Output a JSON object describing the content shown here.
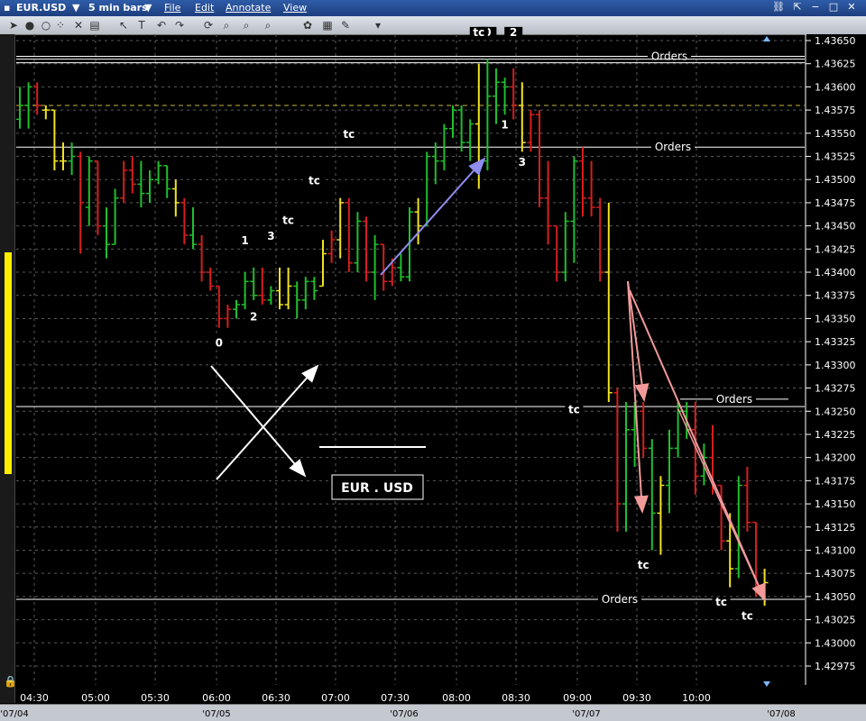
{
  "window": {
    "symbol": "EUR.USD",
    "interval": "5 min bars",
    "menus": [
      "File",
      "Edit",
      "Annotate",
      "View"
    ]
  },
  "toolbar": {
    "icons": [
      "cursor-icon",
      "circle-icon",
      "dots-icon",
      "cross-icon",
      "page-icon",
      "pointer-icon",
      "text-icon",
      "undo-icon",
      "redo-icon",
      "refresh-icon",
      "zoom-in-icon",
      "zoom-out-icon",
      "zoom-reset-icon",
      "palette-icon",
      "grid-icon",
      "dropdown-icon"
    ]
  },
  "colors": {
    "up": "#1fbf2c",
    "down": "#d61e1e",
    "flat": "#f0e320",
    "grid": "#5a5a5a",
    "orders_line": "#ffffff",
    "ref_dashed": "#c8b43a",
    "arrow_blue": "#8f8cf0",
    "arrow_pink": "#f29a9a",
    "scrollbar": "#ffee00"
  },
  "chart_data": {
    "type": "ohlc",
    "x_axis": {
      "time_labels": [
        "04:30",
        "05:00",
        "05:30",
        "06:00",
        "06:30",
        "07:00",
        "07:30",
        "08:00",
        "08:30",
        "09:00",
        "09:30",
        "10:00"
      ],
      "date_labels": [
        "'07/04",
        "'07/05",
        "'07/06",
        "'07/07",
        "'07/08"
      ]
    },
    "y_axis": {
      "range": [
        1.4295,
        1.4366
      ],
      "ticks": [
        "1.43650",
        "1.43625",
        "1.43600",
        "1.43575",
        "1.43550",
        "1.43525",
        "1.43500",
        "1.43475",
        "1.43450",
        "1.43425",
        "1.43400",
        "1.43375",
        "1.43350",
        "1.43325",
        "1.43300",
        "1.43275",
        "1.43250",
        "1.43225",
        "1.43200",
        "1.43175",
        "1.43150",
        "1.43125",
        "1.43100",
        "1.43075",
        "1.43050",
        "1.43025",
        "1.43000",
        "1.42975"
      ]
    },
    "bars": [
      {
        "o": 1.43565,
        "h": 1.436,
        "l": 1.43555,
        "c": 1.4358,
        "d": "up"
      },
      {
        "o": 1.4358,
        "h": 1.43605,
        "l": 1.43555,
        "c": 1.436,
        "d": "up"
      },
      {
        "o": 1.436,
        "h": 1.43605,
        "l": 1.4357,
        "c": 1.4358,
        "d": "down"
      },
      {
        "o": 1.43575,
        "h": 1.4358,
        "l": 1.43565,
        "c": 1.43575,
        "d": "flat"
      },
      {
        "o": 1.43575,
        "h": 1.43575,
        "l": 1.4351,
        "c": 1.4352,
        "d": "flat"
      },
      {
        "o": 1.4352,
        "h": 1.4354,
        "l": 1.4351,
        "c": 1.4352,
        "d": "flat"
      },
      {
        "o": 1.4352,
        "h": 1.4354,
        "l": 1.43505,
        "c": 1.43525,
        "d": "up"
      },
      {
        "o": 1.43525,
        "h": 1.4353,
        "l": 1.4342,
        "c": 1.43475,
        "d": "down"
      },
      {
        "o": 1.4347,
        "h": 1.43525,
        "l": 1.4345,
        "c": 1.4352,
        "d": "up"
      },
      {
        "o": 1.4352,
        "h": 1.4352,
        "l": 1.4344,
        "c": 1.4345,
        "d": "down"
      },
      {
        "o": 1.4345,
        "h": 1.4347,
        "l": 1.43415,
        "c": 1.4343,
        "d": "up"
      },
      {
        "o": 1.4343,
        "h": 1.4349,
        "l": 1.4343,
        "c": 1.4348,
        "d": "up"
      },
      {
        "o": 1.4348,
        "h": 1.4352,
        "l": 1.43475,
        "c": 1.4351,
        "d": "down"
      },
      {
        "o": 1.4351,
        "h": 1.43525,
        "l": 1.43485,
        "c": 1.43495,
        "d": "down"
      },
      {
        "o": 1.43495,
        "h": 1.4352,
        "l": 1.4347,
        "c": 1.43485,
        "d": "up"
      },
      {
        "o": 1.43485,
        "h": 1.4351,
        "l": 1.43475,
        "c": 1.435,
        "d": "up"
      },
      {
        "o": 1.435,
        "h": 1.4352,
        "l": 1.43495,
        "c": 1.43515,
        "d": "up"
      },
      {
        "o": 1.43515,
        "h": 1.43515,
        "l": 1.4348,
        "c": 1.4349,
        "d": "up"
      },
      {
        "o": 1.4349,
        "h": 1.435,
        "l": 1.4346,
        "c": 1.43475,
        "d": "flat"
      },
      {
        "o": 1.43475,
        "h": 1.4348,
        "l": 1.4343,
        "c": 1.4344,
        "d": "down"
      },
      {
        "o": 1.4344,
        "h": 1.4347,
        "l": 1.43425,
        "c": 1.4343,
        "d": "up"
      },
      {
        "o": 1.4343,
        "h": 1.4344,
        "l": 1.4339,
        "c": 1.434,
        "d": "down"
      },
      {
        "o": 1.434,
        "h": 1.43405,
        "l": 1.4338,
        "c": 1.43385,
        "d": "down"
      },
      {
        "o": 1.43385,
        "h": 1.43385,
        "l": 1.4334,
        "c": 1.4335,
        "d": "down"
      },
      {
        "o": 1.4335,
        "h": 1.43365,
        "l": 1.4334,
        "c": 1.4336,
        "d": "down"
      },
      {
        "o": 1.4336,
        "h": 1.4337,
        "l": 1.4335,
        "c": 1.43365,
        "d": "up"
      },
      {
        "o": 1.43365,
        "h": 1.434,
        "l": 1.4336,
        "c": 1.4339,
        "d": "up"
      },
      {
        "o": 1.4339,
        "h": 1.43405,
        "l": 1.4337,
        "c": 1.43375,
        "d": "up"
      },
      {
        "o": 1.43375,
        "h": 1.43405,
        "l": 1.43365,
        "c": 1.4337,
        "d": "down"
      },
      {
        "o": 1.4337,
        "h": 1.43385,
        "l": 1.43365,
        "c": 1.4338,
        "d": "up"
      },
      {
        "o": 1.4338,
        "h": 1.43405,
        "l": 1.4336,
        "c": 1.43365,
        "d": "yellow"
      },
      {
        "o": 1.43365,
        "h": 1.43405,
        "l": 1.4336,
        "c": 1.43385,
        "d": "yellow"
      },
      {
        "o": 1.43385,
        "h": 1.4339,
        "l": 1.4335,
        "c": 1.4337,
        "d": "up"
      },
      {
        "o": 1.4337,
        "h": 1.43395,
        "l": 1.4336,
        "c": 1.4339,
        "d": "up"
      },
      {
        "o": 1.4339,
        "h": 1.43395,
        "l": 1.4337,
        "c": 1.4338,
        "d": "up"
      },
      {
        "o": 1.43385,
        "h": 1.43435,
        "l": 1.43385,
        "c": 1.4342,
        "d": "yellow"
      },
      {
        "o": 1.4342,
        "h": 1.43445,
        "l": 1.4341,
        "c": 1.43435,
        "d": "down"
      },
      {
        "o": 1.43435,
        "h": 1.4348,
        "l": 1.43415,
        "c": 1.43475,
        "d": "yellow"
      },
      {
        "o": 1.43475,
        "h": 1.4348,
        "l": 1.434,
        "c": 1.4341,
        "d": "down"
      },
      {
        "o": 1.4341,
        "h": 1.43465,
        "l": 1.434,
        "c": 1.43455,
        "d": "up"
      },
      {
        "o": 1.43455,
        "h": 1.4346,
        "l": 1.4339,
        "c": 1.434,
        "d": "down"
      },
      {
        "o": 1.434,
        "h": 1.4344,
        "l": 1.4337,
        "c": 1.4343,
        "d": "up"
      },
      {
        "o": 1.4343,
        "h": 1.4343,
        "l": 1.4338,
        "c": 1.4339,
        "d": "down"
      },
      {
        "o": 1.4339,
        "h": 1.43415,
        "l": 1.43385,
        "c": 1.43405,
        "d": "down"
      },
      {
        "o": 1.43405,
        "h": 1.4342,
        "l": 1.4339,
        "c": 1.43395,
        "d": "up"
      },
      {
        "o": 1.43395,
        "h": 1.4347,
        "l": 1.4339,
        "c": 1.43465,
        "d": "up"
      },
      {
        "o": 1.43465,
        "h": 1.4348,
        "l": 1.4343,
        "c": 1.4345,
        "d": "yellow"
      },
      {
        "o": 1.4345,
        "h": 1.4353,
        "l": 1.4345,
        "c": 1.43525,
        "d": "up"
      },
      {
        "o": 1.43525,
        "h": 1.4354,
        "l": 1.43495,
        "c": 1.4352,
        "d": "up"
      },
      {
        "o": 1.4352,
        "h": 1.4356,
        "l": 1.4351,
        "c": 1.43555,
        "d": "up"
      },
      {
        "o": 1.43555,
        "h": 1.4358,
        "l": 1.43545,
        "c": 1.43575,
        "d": "up"
      },
      {
        "o": 1.43575,
        "h": 1.4358,
        "l": 1.4353,
        "c": 1.4354,
        "d": "up"
      },
      {
        "o": 1.4354,
        "h": 1.43565,
        "l": 1.4352,
        "c": 1.4356,
        "d": "up"
      },
      {
        "o": 1.4356,
        "h": 1.43625,
        "l": 1.4349,
        "c": 1.4352,
        "d": "yellow"
      },
      {
        "o": 1.4352,
        "h": 1.4363,
        "l": 1.4351,
        "c": 1.4359,
        "d": "up"
      },
      {
        "o": 1.4359,
        "h": 1.4362,
        "l": 1.4356,
        "c": 1.43605,
        "d": "up"
      },
      {
        "o": 1.43605,
        "h": 1.4361,
        "l": 1.4357,
        "c": 1.436,
        "d": "up"
      },
      {
        "o": 1.436,
        "h": 1.4362,
        "l": 1.43565,
        "c": 1.4358,
        "d": "down"
      },
      {
        "o": 1.4358,
        "h": 1.43605,
        "l": 1.4353,
        "c": 1.4354,
        "d": "yellow"
      },
      {
        "o": 1.4354,
        "h": 1.43575,
        "l": 1.4353,
        "c": 1.4357,
        "d": "down"
      },
      {
        "o": 1.4357,
        "h": 1.43575,
        "l": 1.4347,
        "c": 1.4348,
        "d": "down"
      },
      {
        "o": 1.4348,
        "h": 1.4352,
        "l": 1.4343,
        "c": 1.4345,
        "d": "down"
      },
      {
        "o": 1.4345,
        "h": 1.4345,
        "l": 1.4339,
        "c": 1.434,
        "d": "down"
      },
      {
        "o": 1.434,
        "h": 1.43465,
        "l": 1.4339,
        "c": 1.43455,
        "d": "up"
      },
      {
        "o": 1.43455,
        "h": 1.43525,
        "l": 1.4341,
        "c": 1.4352,
        "d": "up"
      },
      {
        "o": 1.4352,
        "h": 1.43535,
        "l": 1.4346,
        "c": 1.4348,
        "d": "down"
      },
      {
        "o": 1.4348,
        "h": 1.4352,
        "l": 1.4346,
        "c": 1.4347,
        "d": "down"
      },
      {
        "o": 1.4347,
        "h": 1.4348,
        "l": 1.4339,
        "c": 1.434,
        "d": "down"
      },
      {
        "o": 1.434,
        "h": 1.43475,
        "l": 1.4326,
        "c": 1.4327,
        "d": "yellow"
      },
      {
        "o": 1.4327,
        "h": 1.43275,
        "l": 1.4312,
        "c": 1.4315,
        "d": "down"
      },
      {
        "o": 1.4315,
        "h": 1.4326,
        "l": 1.4312,
        "c": 1.4323,
        "d": "up"
      },
      {
        "o": 1.4323,
        "h": 1.4326,
        "l": 1.4319,
        "c": 1.4325,
        "d": "up"
      },
      {
        "o": 1.4325,
        "h": 1.4326,
        "l": 1.432,
        "c": 1.4321,
        "d": "down"
      },
      {
        "o": 1.4321,
        "h": 1.4322,
        "l": 1.431,
        "c": 1.4314,
        "d": "up"
      },
      {
        "o": 1.4314,
        "h": 1.4318,
        "l": 1.43095,
        "c": 1.4317,
        "d": "yellow"
      },
      {
        "o": 1.4317,
        "h": 1.4323,
        "l": 1.4314,
        "c": 1.4321,
        "d": "up"
      },
      {
        "o": 1.4321,
        "h": 1.4326,
        "l": 1.432,
        "c": 1.4325,
        "d": "up"
      },
      {
        "o": 1.4325,
        "h": 1.4326,
        "l": 1.4322,
        "c": 1.4323,
        "d": "up"
      },
      {
        "o": 1.4323,
        "h": 1.4326,
        "l": 1.4316,
        "c": 1.4318,
        "d": "down"
      },
      {
        "o": 1.4318,
        "h": 1.43215,
        "l": 1.4317,
        "c": 1.432,
        "d": "up"
      },
      {
        "o": 1.432,
        "h": 1.43235,
        "l": 1.4316,
        "c": 1.4317,
        "d": "down"
      },
      {
        "o": 1.4317,
        "h": 1.4317,
        "l": 1.431,
        "c": 1.4311,
        "d": "down"
      },
      {
        "o": 1.4311,
        "h": 1.4314,
        "l": 1.4306,
        "c": 1.4308,
        "d": "yellow"
      },
      {
        "o": 1.4308,
        "h": 1.4318,
        "l": 1.4307,
        "c": 1.4317,
        "d": "up"
      },
      {
        "o": 1.4317,
        "h": 1.4319,
        "l": 1.4312,
        "c": 1.4313,
        "d": "down"
      },
      {
        "o": 1.4313,
        "h": 1.4313,
        "l": 1.4305,
        "c": 1.4306,
        "d": "down"
      },
      {
        "o": 1.4306,
        "h": 1.4308,
        "l": 1.4304,
        "c": 1.43065,
        "d": "yellow"
      }
    ],
    "horizontal_lines": [
      {
        "price": 1.43633,
        "label": "Orders",
        "style": "solid"
      },
      {
        "price": 1.4363,
        "label": "",
        "style": "solid"
      },
      {
        "price": 1.43626,
        "label": "",
        "style": "solid"
      },
      {
        "price": 1.4358,
        "label": "",
        "style": "dashed"
      },
      {
        "price": 1.43535,
        "label": "Orders",
        "style": "solid"
      },
      {
        "price": 1.43255,
        "label": "",
        "style": "solid"
      },
      {
        "price": 1.43263,
        "label": "Orders",
        "style": "solid"
      },
      {
        "price": 1.43047,
        "label": "Orders",
        "style": "solid"
      }
    ],
    "annotations": {
      "numbers": [
        {
          "text": "0",
          "bar": 23,
          "price": 1.4332
        },
        {
          "text": "1",
          "bar": 26,
          "price": 1.4343
        },
        {
          "text": "2",
          "bar": 27,
          "price": 1.43348
        },
        {
          "text": "3",
          "bar": 29,
          "price": 1.43435
        },
        {
          "text": "0",
          "bar": 54,
          "price": 1.43655
        },
        {
          "text": "2",
          "bar": 57,
          "price": 1.43655
        },
        {
          "text": "1",
          "bar": 56,
          "price": 1.43555
        },
        {
          "text": "3",
          "bar": 58,
          "price": 1.43515
        },
        {
          "text": "tc",
          "bar": 31,
          "price": 1.43452
        },
        {
          "text": "tc",
          "bar": 34,
          "price": 1.43495
        },
        {
          "text": "tc",
          "bar": 38,
          "price": 1.43545
        },
        {
          "text": "tc",
          "bar": 53,
          "price": 1.43655
        },
        {
          "text": "tc",
          "bar": 64,
          "price": 1.43248
        },
        {
          "text": "tc",
          "bar": 72,
          "price": 1.4308
        },
        {
          "text": "tc",
          "bar": 81,
          "price": 1.4304
        },
        {
          "text": "tc",
          "bar": 84,
          "price": 1.43025
        }
      ],
      "label_box": "EUR . USD"
    }
  }
}
